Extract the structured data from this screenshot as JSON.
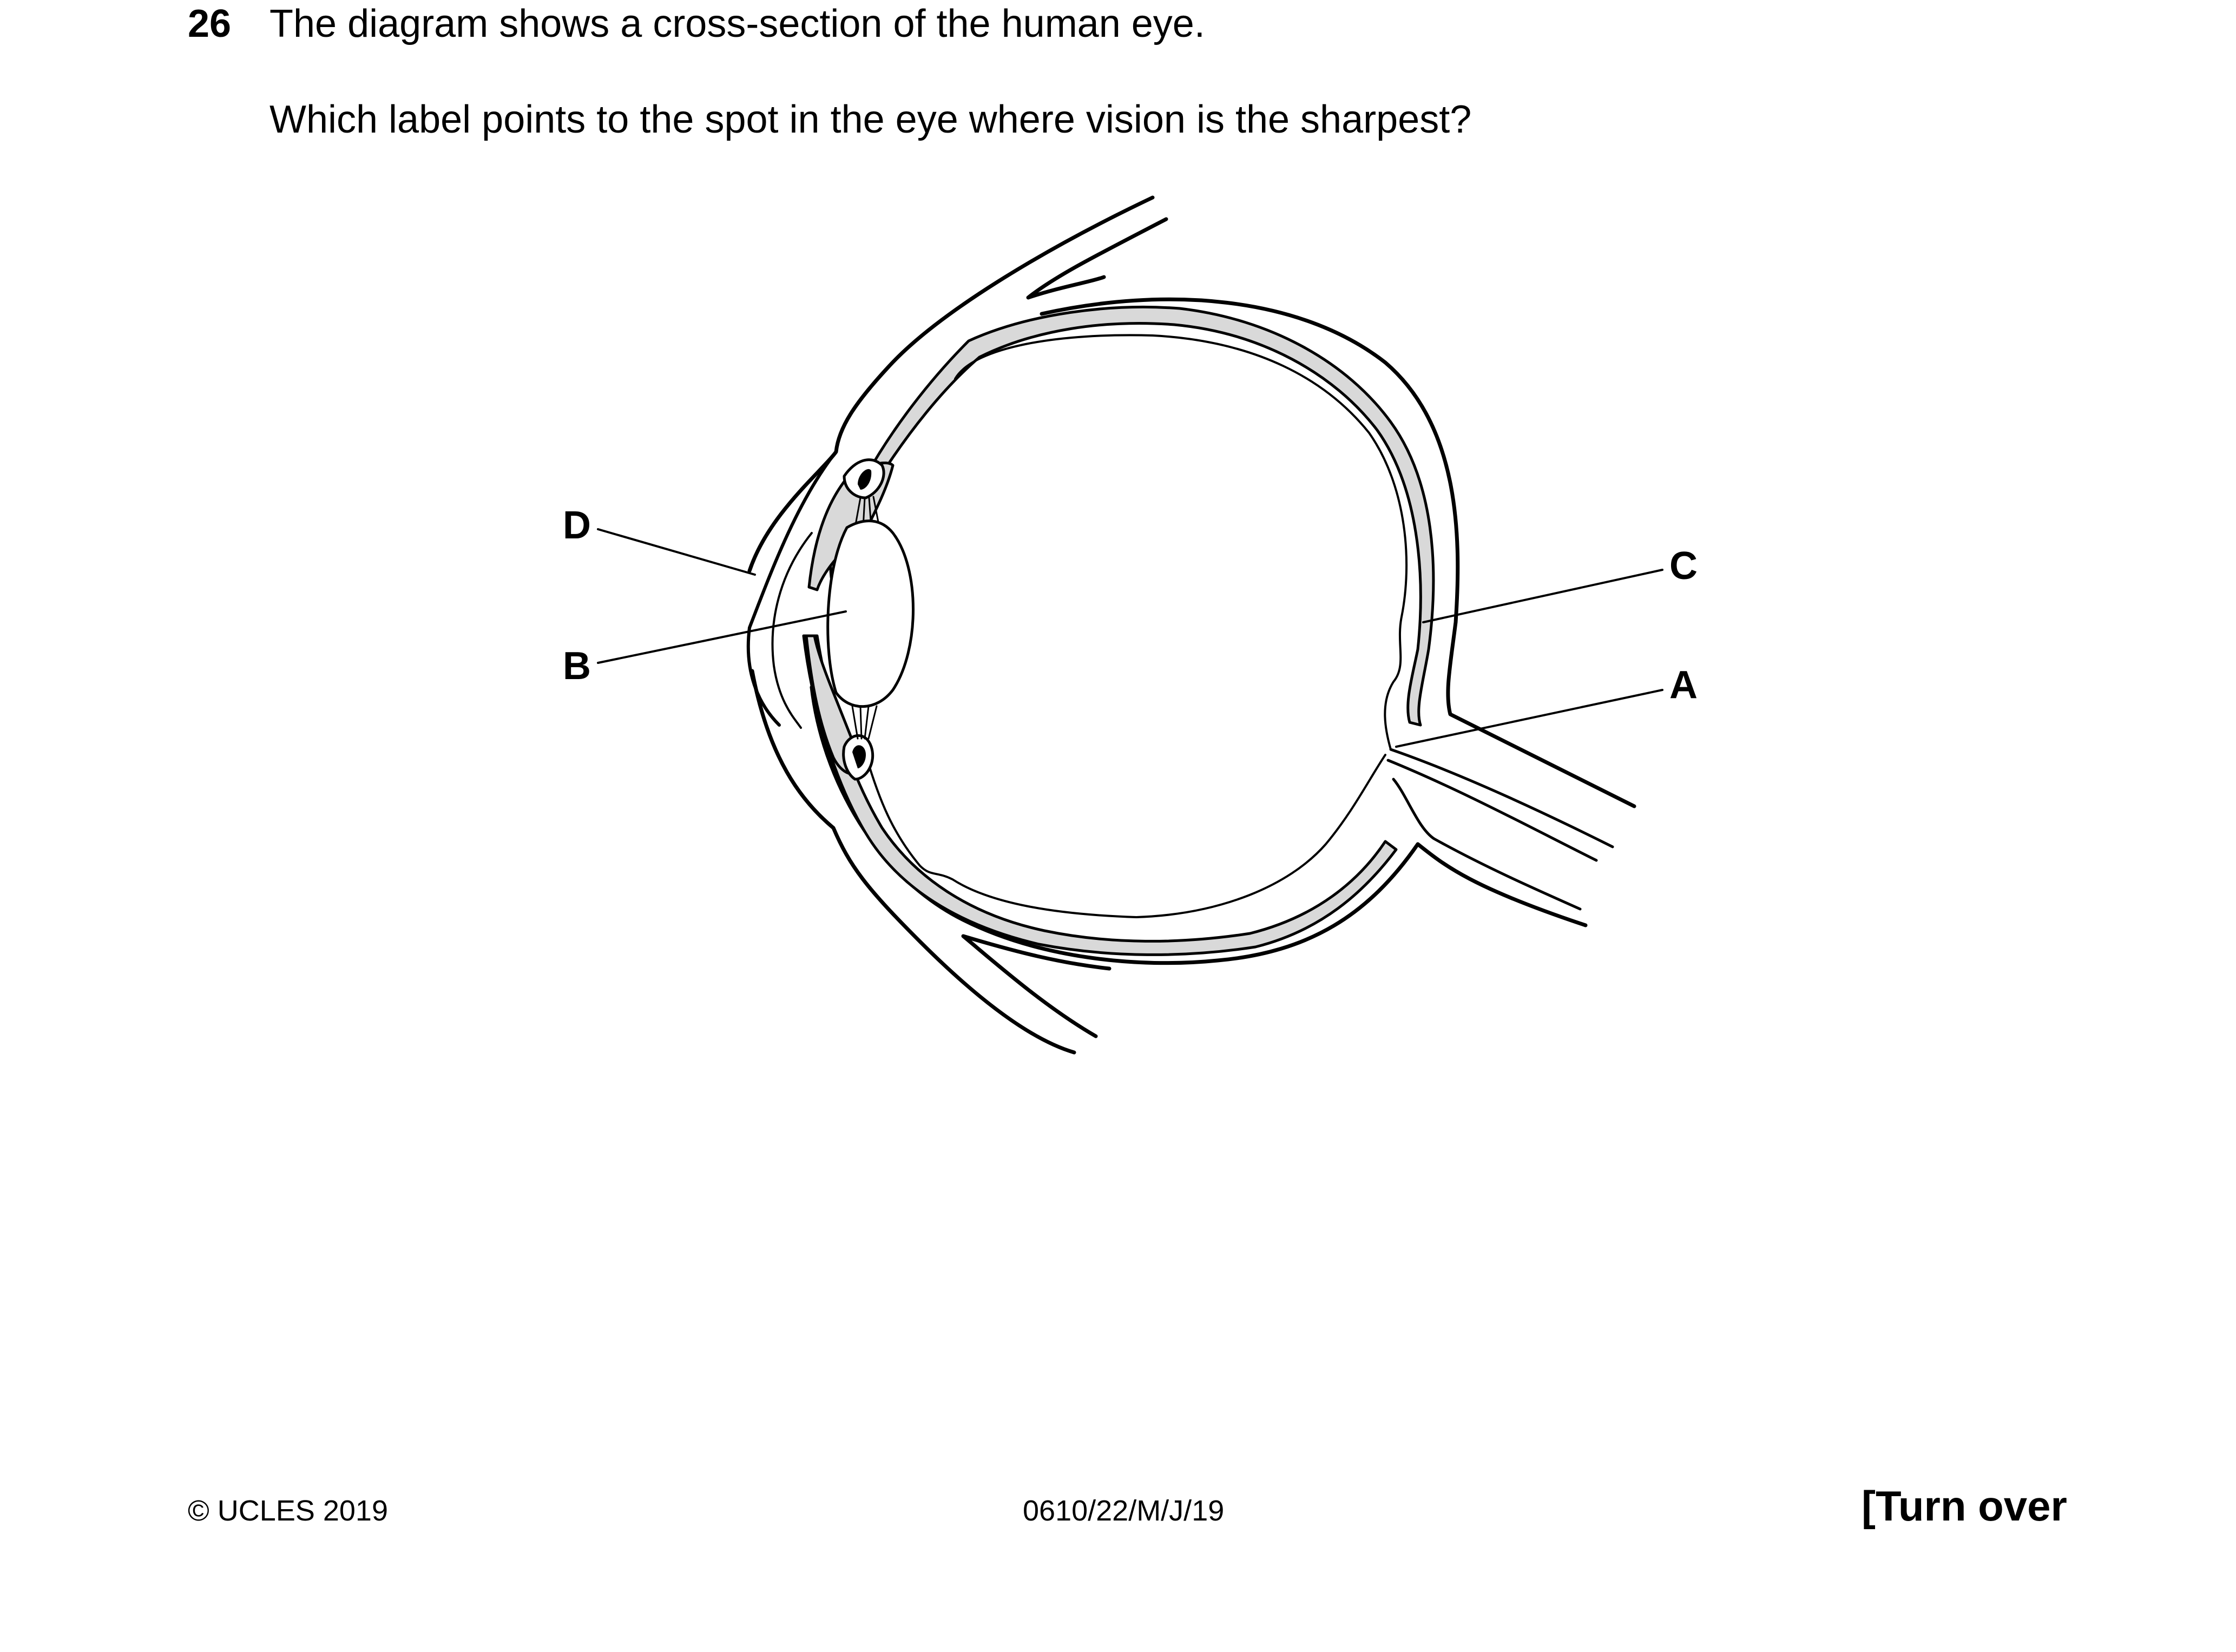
{
  "question": {
    "number": "26",
    "line1": "The diagram shows a cross-section of the human eye.",
    "line2": "Which label points to the spot in the eye where vision is the sharpest?"
  },
  "diagram": {
    "labels": {
      "A": "A",
      "B": "B",
      "C": "C",
      "D": "D"
    }
  },
  "footer": {
    "copyright": "© UCLES 2019",
    "paper_code": "0610/22/M/J/19",
    "turn_over": "[Turn over"
  }
}
